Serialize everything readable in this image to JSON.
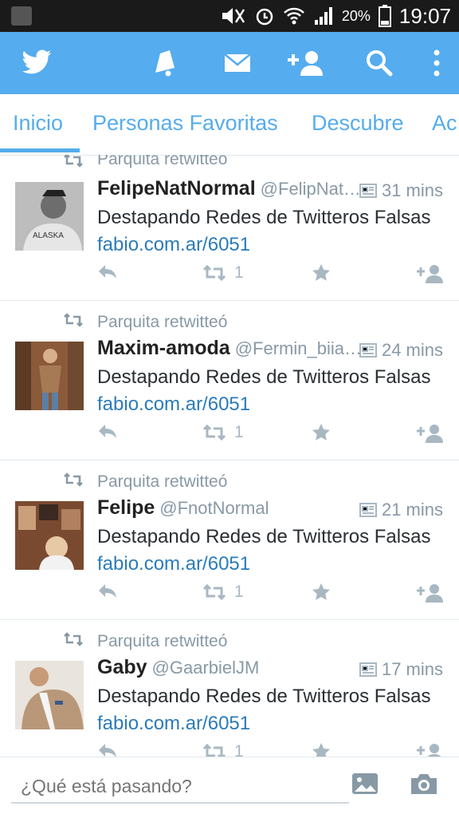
{
  "status_bar": {
    "battery": "20%",
    "time": "19:07"
  },
  "app_bar": {
    "icons": [
      "twitter-bird-icon",
      "bell-icon",
      "envelope-icon",
      "add-user-icon",
      "search-icon",
      "more-vert-icon"
    ]
  },
  "tabs": [
    {
      "label": "Inicio",
      "active": true
    },
    {
      "label": "Personas Favoritas",
      "active": false
    },
    {
      "label": "Descubre",
      "active": false
    },
    {
      "label": "Ac",
      "active": false
    }
  ],
  "tweets": [
    {
      "retweeted_by": "Parquita retwitteó",
      "name": "FelipeNatNormal",
      "handle": "@FelipNat…",
      "time": "31 mins",
      "text": "Destapando Redes de Twitteros Falsas",
      "link": "fabio.com.ar/6051",
      "retweet_count": "1"
    },
    {
      "retweeted_by": "Parquita retwitteó",
      "name": "Maxim-amoda",
      "handle": "@Fermin_biia…",
      "time": "24 mins",
      "text": "Destapando Redes de Twitteros Falsas",
      "link": "fabio.com.ar/6051",
      "retweet_count": "1"
    },
    {
      "retweeted_by": "Parquita retwitteó",
      "name": "Felipe",
      "handle": "@FnotNormal",
      "time": "21 mins",
      "text": "Destapando Redes de Twitteros Falsas",
      "link": "fabio.com.ar/6051",
      "retweet_count": "1"
    },
    {
      "retweeted_by": "Parquita retwitteó",
      "name": "Gaby",
      "handle": "@GaarbielJM",
      "time": "17 mins",
      "text": "Destapando Redes de Twitteros Falsas",
      "link": "fabio.com.ar/6051",
      "retweet_count": "1"
    }
  ],
  "compose": {
    "placeholder": "¿Qué está pasando?"
  },
  "colors": {
    "brand": "#55acee",
    "link": "#2b7bb9",
    "muted": "#8899a6"
  }
}
